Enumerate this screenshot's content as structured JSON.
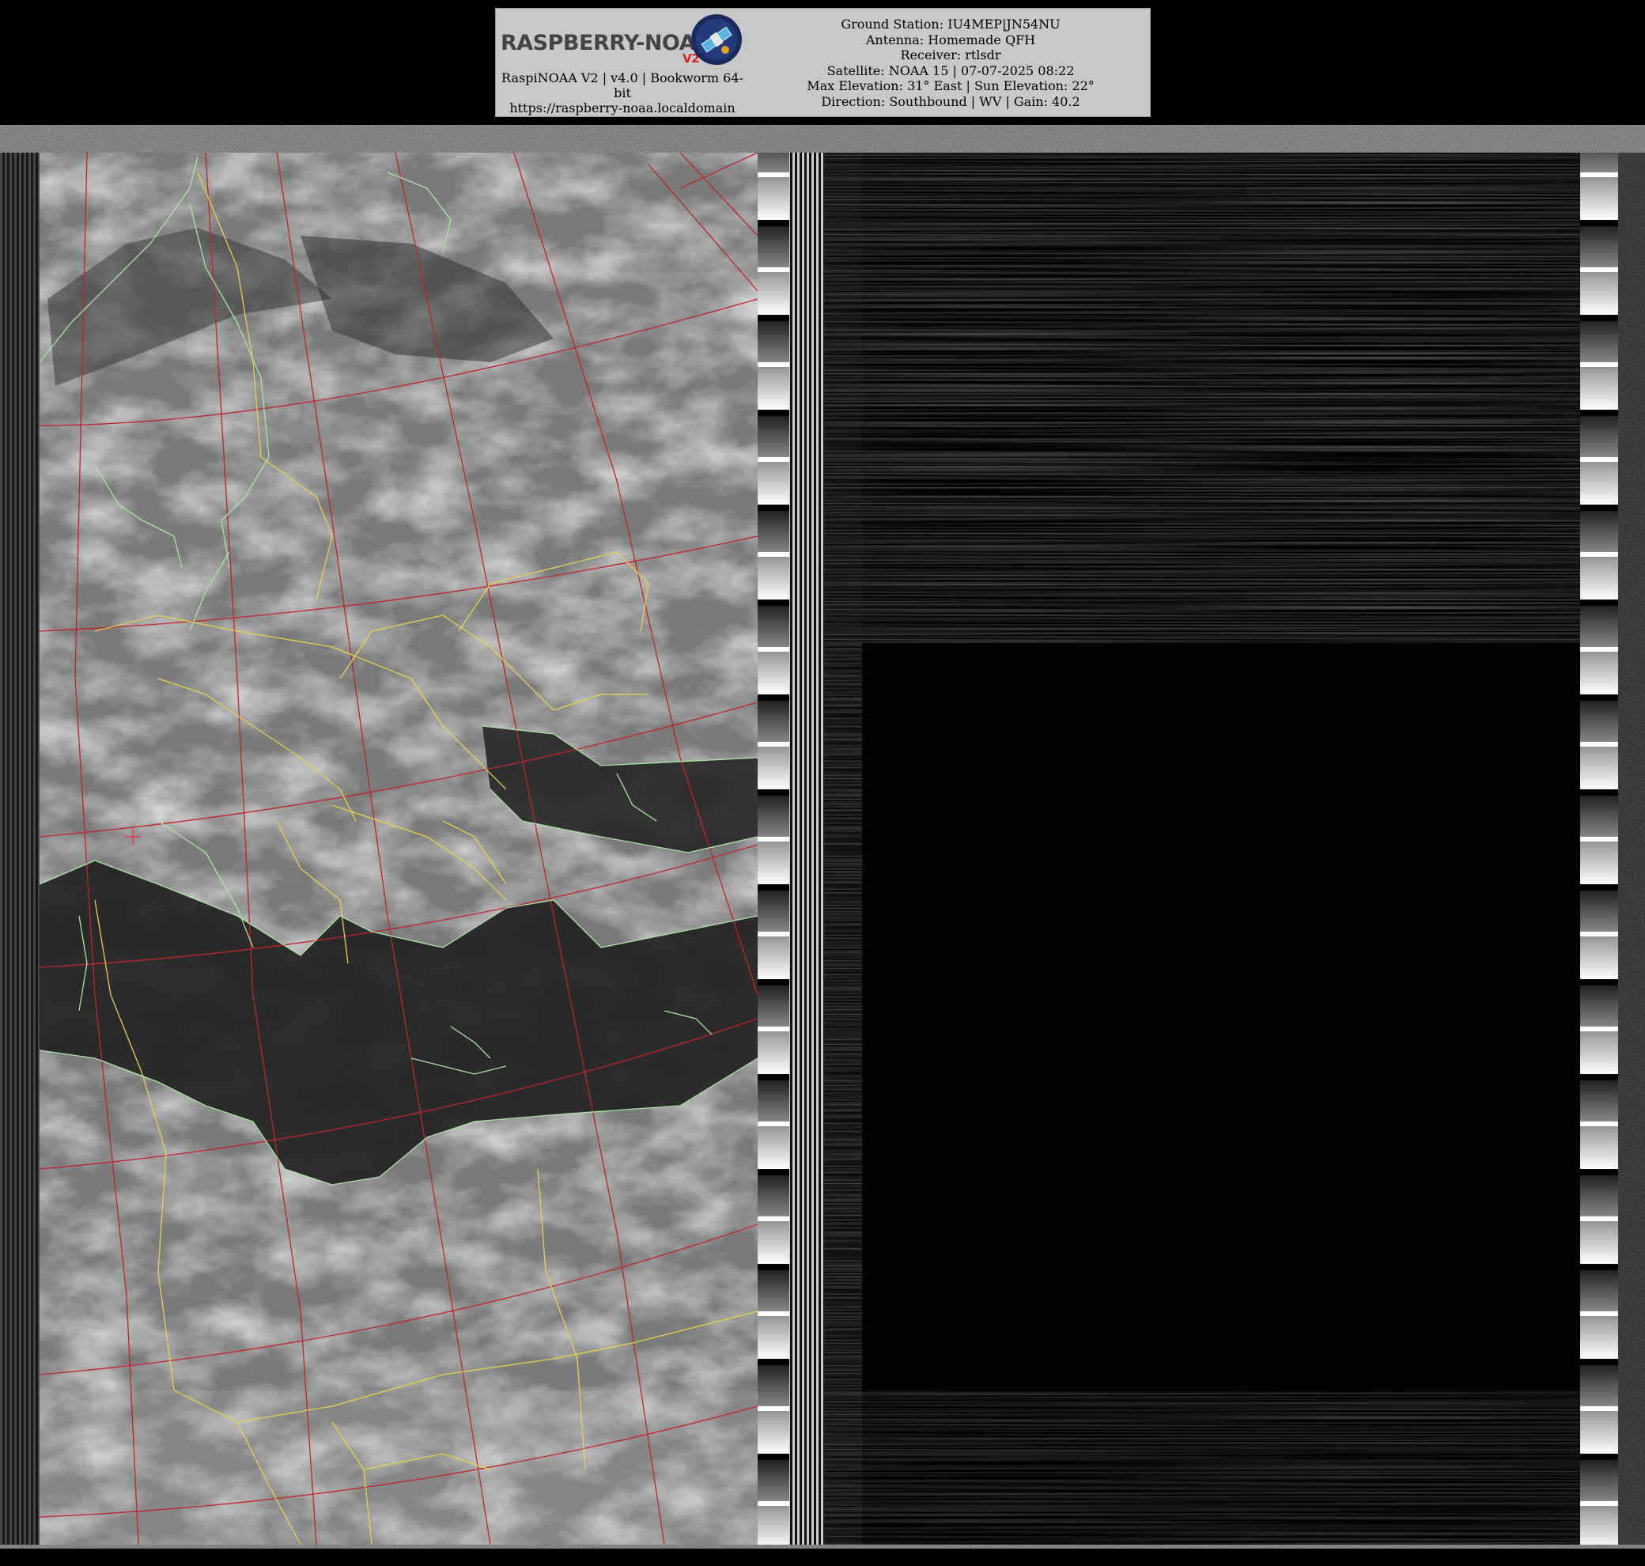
{
  "header": {
    "logo_text": "RASPBERRY-NOAA",
    "logo_version_badge": "V2",
    "caption_line1": "RaspiNOAA V2 | v4.0 | Bookworm 64-",
    "caption_line2": "bit",
    "caption_line3": "https://raspberry-noaa.localdomain",
    "station_lines": [
      "Ground Station: IU4MEP|JN54NU",
      "Antenna: Homemade QFH",
      "Receiver: rtlsdr",
      "Satellite: NOAA 15 | 07-07-2025 08:22",
      "Max Elevation: 31° East | Sun Elevation: 22°",
      "Direction: Southbound | WV | Gain: 40.2"
    ]
  },
  "imagery": {
    "panels": [
      {
        "channel": "visible",
        "overlay_icon": "crosshair-icon"
      },
      {
        "channel": "infrared",
        "overlay_icon": "crosshair-icon"
      }
    ],
    "colors": {
      "grid": "#c0242a",
      "country_border": "#e6d24a",
      "coastline": "#a8e6a0",
      "marker": "#e05060"
    }
  }
}
